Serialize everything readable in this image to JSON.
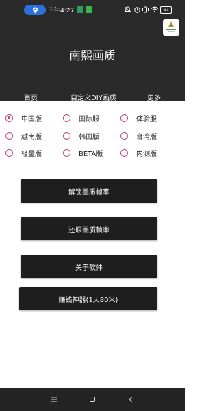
{
  "status_bar": {
    "time": "下午4:27",
    "battery": "67",
    "icons": [
      "location-icon",
      "app-notification-icon",
      "message-icon",
      "silent-icon",
      "alarm-icon",
      "vibrate-icon",
      "wifi-icon",
      "battery-icon"
    ]
  },
  "app": {
    "title": "南熙画质",
    "header_bg": "#2a2a2a",
    "accent": "#c2457e"
  },
  "tabs": [
    {
      "label": "首页"
    },
    {
      "label": "自定义DIY画质"
    },
    {
      "label": "更多"
    }
  ],
  "versions": {
    "selected": "中国版",
    "options": [
      [
        "中国版",
        "国际服",
        "体验服"
      ],
      [
        "越南版",
        "韩国版",
        "台湾版"
      ],
      [
        "轻量版",
        "BETA版",
        "内测版"
      ]
    ]
  },
  "buttons": {
    "unlock": "解锁画质帧率",
    "restore": "还原画质帧率",
    "about": "关于软件",
    "earn": "赚钱神器(1天80米)"
  },
  "nav": {
    "icons": [
      "menu-icon",
      "home-icon",
      "back-icon"
    ]
  }
}
